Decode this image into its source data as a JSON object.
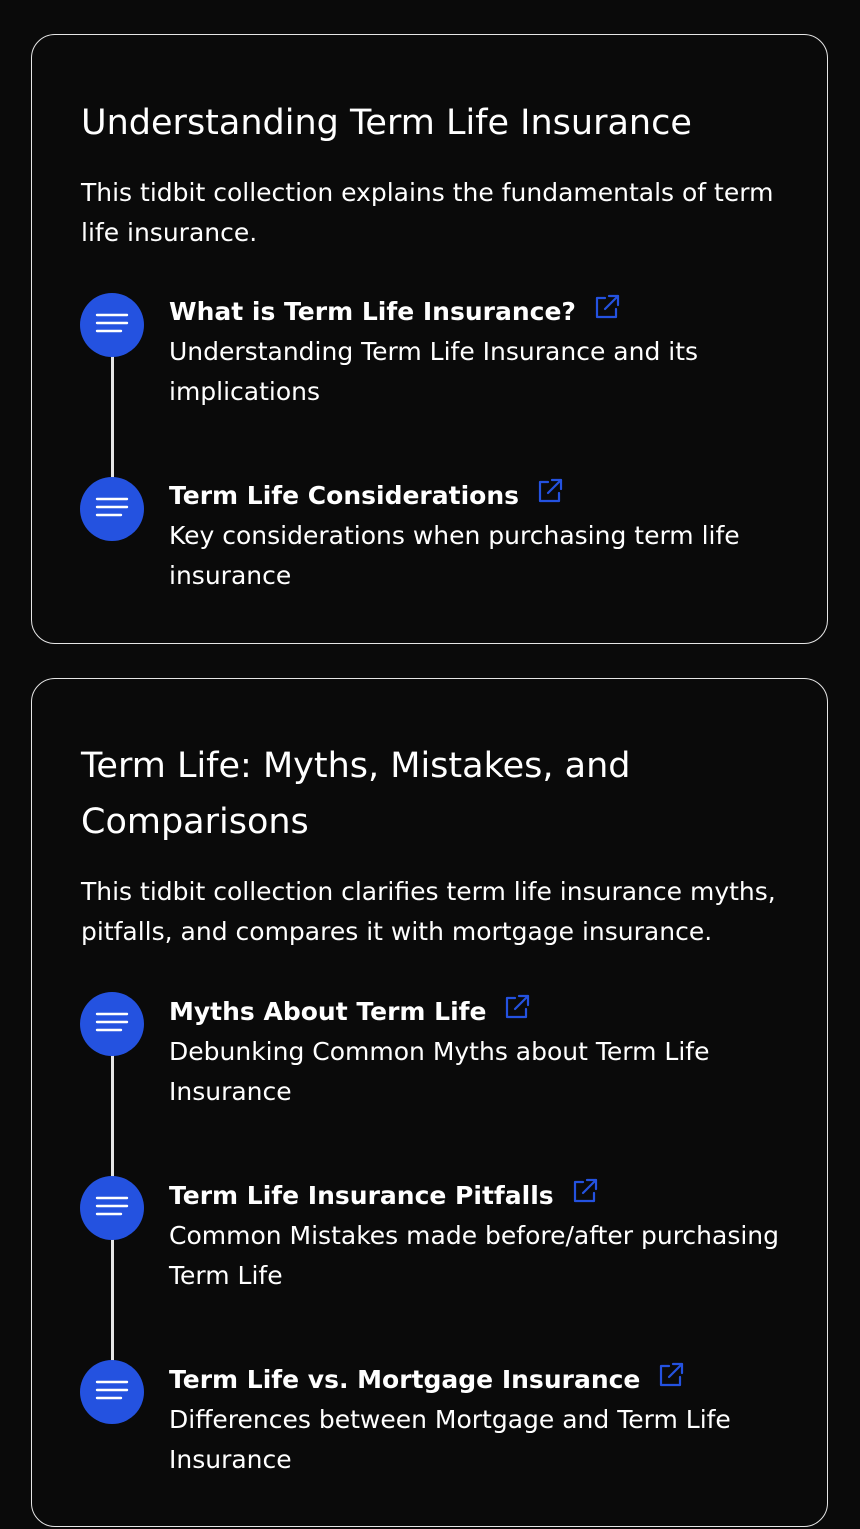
{
  "collections": [
    {
      "title": "Understanding Term Life Insurance",
      "description": "This tidbit collection explains the fundamentals of term life insurance.",
      "items": [
        {
          "title": "What is Term Life Insurance?",
          "description": "Understanding Term Life Insurance and its implications",
          "icon": "text-lines-icon",
          "link_icon": "external-link-icon"
        },
        {
          "title": "Term Life Considerations",
          "description": "Key considerations when purchasing term life insurance",
          "icon": "text-lines-icon",
          "link_icon": "external-link-icon"
        }
      ]
    },
    {
      "title": "Term Life: Myths, Mistakes, and Comparisons",
      "description": "This tidbit collection clarifies term life insurance myths, pitfalls, and compares it with mortgage insurance.",
      "items": [
        {
          "title": "Myths About Term Life",
          "description": "Debunking Common Myths about Term Life Insurance",
          "icon": "text-lines-icon",
          "link_icon": "external-link-icon"
        },
        {
          "title": "Term Life Insurance Pitfalls",
          "description": "Common Mistakes made before/after purchasing Term Life",
          "icon": "text-lines-icon",
          "link_icon": "external-link-icon"
        },
        {
          "title": "Term Life vs. Mortgage Insurance",
          "description": "Differences between Mortgage and Term Life Insurance",
          "icon": "text-lines-icon",
          "link_icon": "external-link-icon"
        }
      ]
    }
  ],
  "colors": {
    "background": "#0a0a0a",
    "card_border": "#e6e6e6",
    "accent": "#2452e0",
    "text": "#ffffff"
  }
}
